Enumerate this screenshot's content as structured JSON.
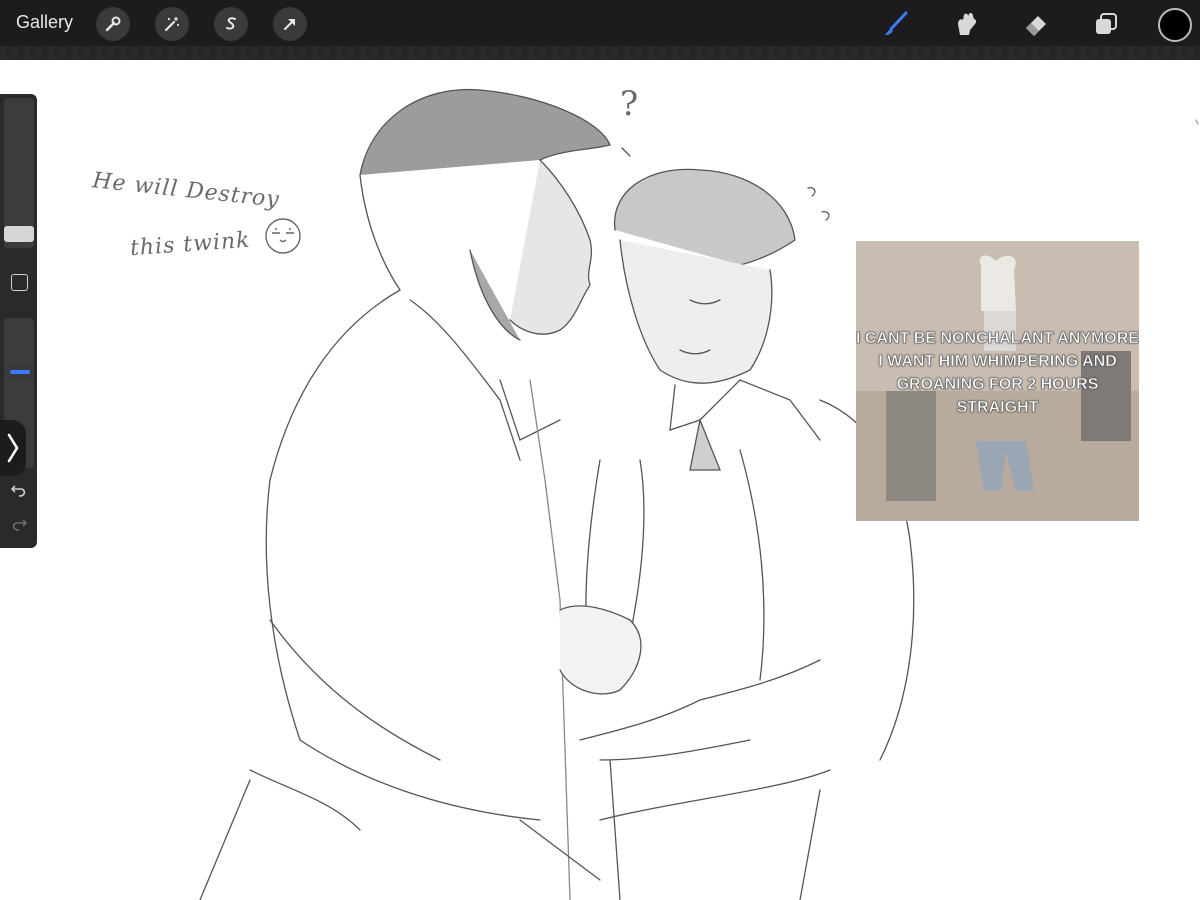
{
  "toolbar": {
    "gallery_label": "Gallery",
    "left_tools": [
      "wrench-icon",
      "magic-wand-icon",
      "selection-s-icon",
      "transform-arrow-icon"
    ],
    "right_tools": [
      "brush-icon",
      "smudge-icon",
      "eraser-icon",
      "layers-icon"
    ],
    "active_tool": "brush",
    "active_color": "#000000",
    "accent_color": "#3a7bff"
  },
  "sidebar": {
    "brush_size_level": 0.84,
    "opacity_level": 0.36,
    "undo_icon": "undo-icon",
    "redo_icon": "redo-icon"
  },
  "canvas": {
    "note_line1": "He will Destroy",
    "note_line2": "this twink",
    "question_mark": "?",
    "reference_caption": "I CANT BE NONCHALANT ANYMORE I WANT HIM WHIMPERING AND GROANING FOR 2 HOURS STRAIGHT"
  }
}
